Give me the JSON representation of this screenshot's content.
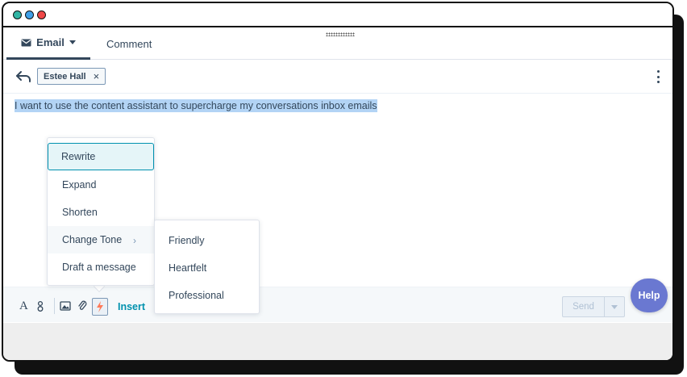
{
  "window": {
    "controls": [
      {
        "name": "close",
        "color": "#ef4747"
      },
      {
        "name": "minimize",
        "color": "#31b5a4"
      },
      {
        "name": "maximize",
        "color": "#3fa0e8"
      }
    ]
  },
  "tabs": {
    "email_label": "Email",
    "comment_label": "Comment"
  },
  "recipients": {
    "chip_name": "Estee Hall",
    "chip_remove": "×"
  },
  "editor": {
    "body_text": "I want to use the content assistant to supercharge my conversations inbox emails"
  },
  "ai_menu": {
    "items": [
      {
        "label": "Rewrite",
        "state": "active"
      },
      {
        "label": "Expand"
      },
      {
        "label": "Shorten"
      },
      {
        "label": "Change Tone",
        "has_submenu": true
      },
      {
        "label": "Draft a message"
      }
    ],
    "submenu_chevron": "›"
  },
  "tone_submenu": {
    "items": [
      {
        "label": "Friendly"
      },
      {
        "label": "Heartfelt"
      },
      {
        "label": "Professional"
      }
    ]
  },
  "toolbar": {
    "text_format_glyph": "A",
    "insert_label": "Insert",
    "send_label": "Send"
  },
  "help": {
    "label": "Help"
  },
  "icons": [
    "mail-icon",
    "caret-down-icon",
    "reply-back-icon",
    "close-icon",
    "kebab-icon",
    "text-format-icon",
    "personalize-icon",
    "image-icon",
    "attachment-icon",
    "lightning-icon",
    "chevron-right-icon"
  ],
  "colors": {
    "accent": "#0091ae",
    "text": "#33475b",
    "selection": "#b3d4f5",
    "help": "#6a78d1",
    "ai_icon": "#ff7a59"
  }
}
